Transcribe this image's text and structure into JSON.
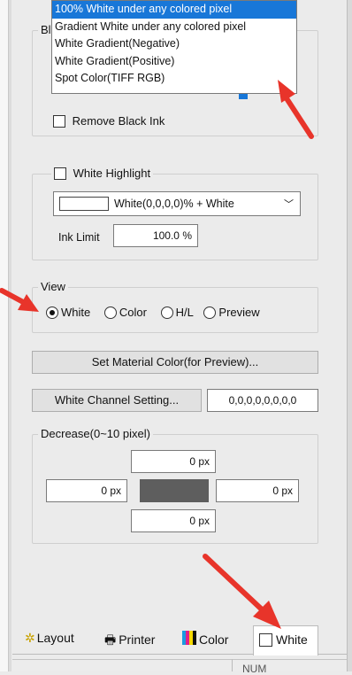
{
  "top_group": {
    "title_fragment": "Bl",
    "dropdown_options": [
      "100% White under any colored pixel",
      "Gradient White under any colored pixel",
      "White Gradient(Negative)",
      "White Gradient(Positive)",
      "Spot Color(TIFF RGB)"
    ],
    "selected_index": 0,
    "remove_black_ink_label": "Remove Black Ink",
    "remove_black_ink_checked": false
  },
  "white_highlight": {
    "label": "White Highlight",
    "checked": false,
    "select_value": "White(0,0,0,0)% + White",
    "ink_limit_label": "Ink Limit",
    "ink_limit_value": "100.0 %"
  },
  "view": {
    "title": "View",
    "options": [
      "White",
      "Color",
      "H/L",
      "Preview"
    ],
    "selected": "White"
  },
  "buttons": {
    "set_material_color": "Set Material Color(for Preview)...",
    "white_channel_setting": "White Channel Setting...",
    "white_channel_value": "0,0,0,0,0,0,0,0"
  },
  "decrease": {
    "title": "Decrease(0~10 pixel)",
    "top": "0 px",
    "left": "0 px",
    "right": "0 px",
    "bottom": "0 px",
    "center_color": "#5e5e5e"
  },
  "tabs": [
    {
      "label": "Layout",
      "icon": "layout-icon"
    },
    {
      "label": "Printer",
      "icon": "printer-icon"
    },
    {
      "label": "Color",
      "icon": "color-bars-icon"
    },
    {
      "label": "White",
      "icon": "white-square-icon"
    }
  ],
  "active_tab": "White",
  "status": {
    "num": "NUM"
  },
  "colors": {
    "annotation_arrow": "#e8342a",
    "selection": "#1877d8"
  }
}
